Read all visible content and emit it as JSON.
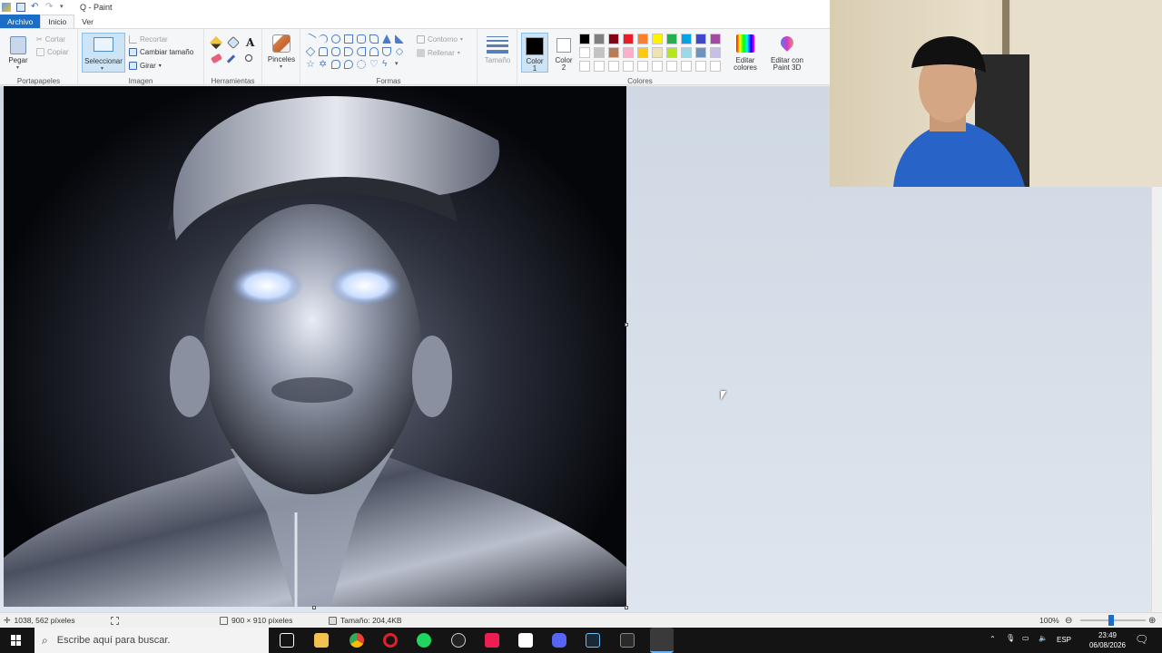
{
  "window": {
    "title": "Q - Paint"
  },
  "tabs": [
    {
      "label": "Archivo"
    },
    {
      "label": "Inicio"
    },
    {
      "label": "Ver"
    }
  ],
  "ribbon": {
    "clipboard": {
      "group": "Portapapeles",
      "paste": "Pegar",
      "cut": "Cortar",
      "copy": "Copiar"
    },
    "image": {
      "group": "Imagen",
      "select": "Seleccionar",
      "crop": "Recortar",
      "resize": "Cambiar tamaño",
      "rotate": "Girar"
    },
    "tools": {
      "group": "Herramientas"
    },
    "brushes": {
      "label": "Pinceles"
    },
    "shapes": {
      "group": "Formas",
      "outline": "Contorno",
      "fill": "Rellenar"
    },
    "size": {
      "label": "Tamaño"
    },
    "colors": {
      "group": "Colores",
      "color1_line1": "Color",
      "color1_line2": "1",
      "color2_line1": "Color",
      "color2_line2": "2",
      "edit_line1": "Editar",
      "edit_line2": "colores",
      "paint3d_line1": "Editar con",
      "paint3d_line2": "Paint 3D",
      "palette": [
        "#000000",
        "#7f7f7f",
        "#880015",
        "#ed1c24",
        "#ff7f27",
        "#fff200",
        "#22b14c",
        "#00a2e8",
        "#3f48cc",
        "#a349a4",
        "#ffffff",
        "#c3c3c3",
        "#b97a57",
        "#ffaec9",
        "#ffc90e",
        "#efe4b0",
        "#b5e61d",
        "#99d9ea",
        "#7092be",
        "#c8bfe7",
        "#ffffff",
        "#ffffff",
        "#ffffff",
        "#ffffff",
        "#ffffff",
        "#ffffff",
        "#ffffff",
        "#ffffff",
        "#ffffff",
        "#ffffff"
      ]
    }
  },
  "status": {
    "cursor_pos": "1038, 562 píxeles",
    "dimensions": "900 × 910 píxeles",
    "file_size": "Tamaño: 204,4KB",
    "zoom": "100%"
  },
  "taskbar": {
    "search_placeholder": "Escribe aquí para buscar.",
    "lang": "ESP",
    "time": "23:49",
    "date": "06/08/2026"
  }
}
